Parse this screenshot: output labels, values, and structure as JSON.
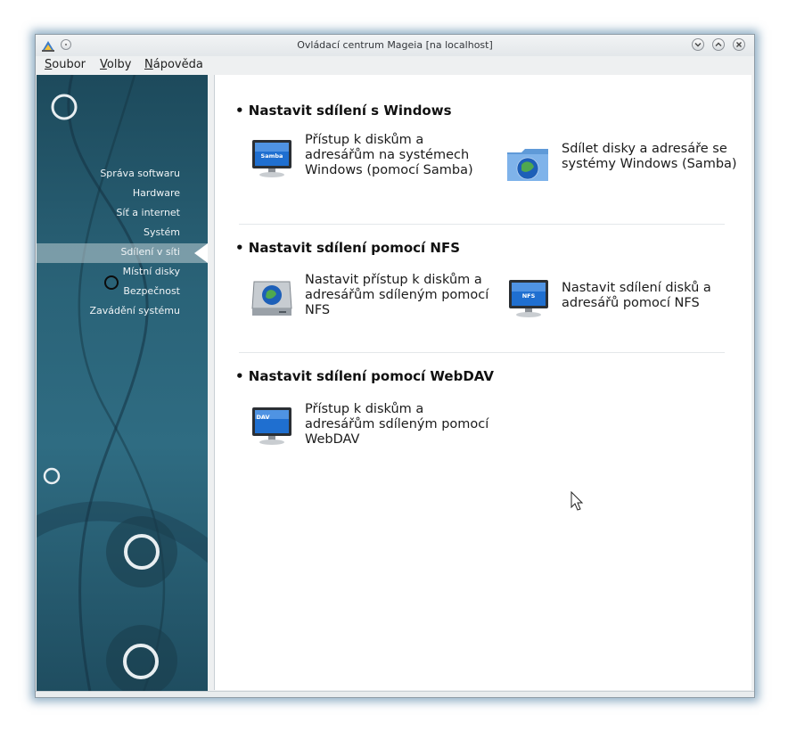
{
  "window": {
    "title": "Ovládací centrum Mageia  [na localhost]"
  },
  "menubar": [
    {
      "underline": "S",
      "rest": "oubor"
    },
    {
      "underline": "V",
      "rest": "olby"
    },
    {
      "underline": "N",
      "rest": "ápověda"
    }
  ],
  "sidebar": {
    "items": [
      "Správa softwaru",
      "Hardware",
      "Síť a internet",
      "Systém",
      "Sdílení v síti",
      "Místní disky",
      "Bezpečnost",
      "Zavádění systému"
    ],
    "active_index": 4
  },
  "sections": [
    {
      "title": "• Nastavit sdílení s Windows",
      "items": [
        {
          "label": "Přístup k diskům a adresářům na systémech Windows (pomocí Samba)",
          "icon": "samba-monitor-icon",
          "icon_text": "Samba"
        },
        {
          "label": "Sdílet disky a adresáře se systémy Windows (Samba)",
          "icon": "shared-folder-globe-icon"
        }
      ]
    },
    {
      "title": "• Nastavit sdílení pomocí NFS",
      "items": [
        {
          "label": "Nastavit přístup k diskům a adresářům sdíleným pomocí NFS",
          "icon": "network-drive-globe-icon"
        },
        {
          "label": "Nastavit sdílení disků a adresářů pomocí NFS",
          "icon": "nfs-monitor-icon",
          "icon_text": "NFS"
        }
      ]
    },
    {
      "title": "• Nastavit sdílení pomocí WebDAV",
      "items": [
        {
          "label": "Přístup k diskům a adresářům sdíleným pomocí WebDAV",
          "icon": "dav-monitor-icon",
          "icon_text": "DAV"
        }
      ]
    }
  ],
  "colors": {
    "sidebar_bg": "#2a6378",
    "window_glow": "#376e96",
    "monitor_screen": "#1f6fd0"
  }
}
